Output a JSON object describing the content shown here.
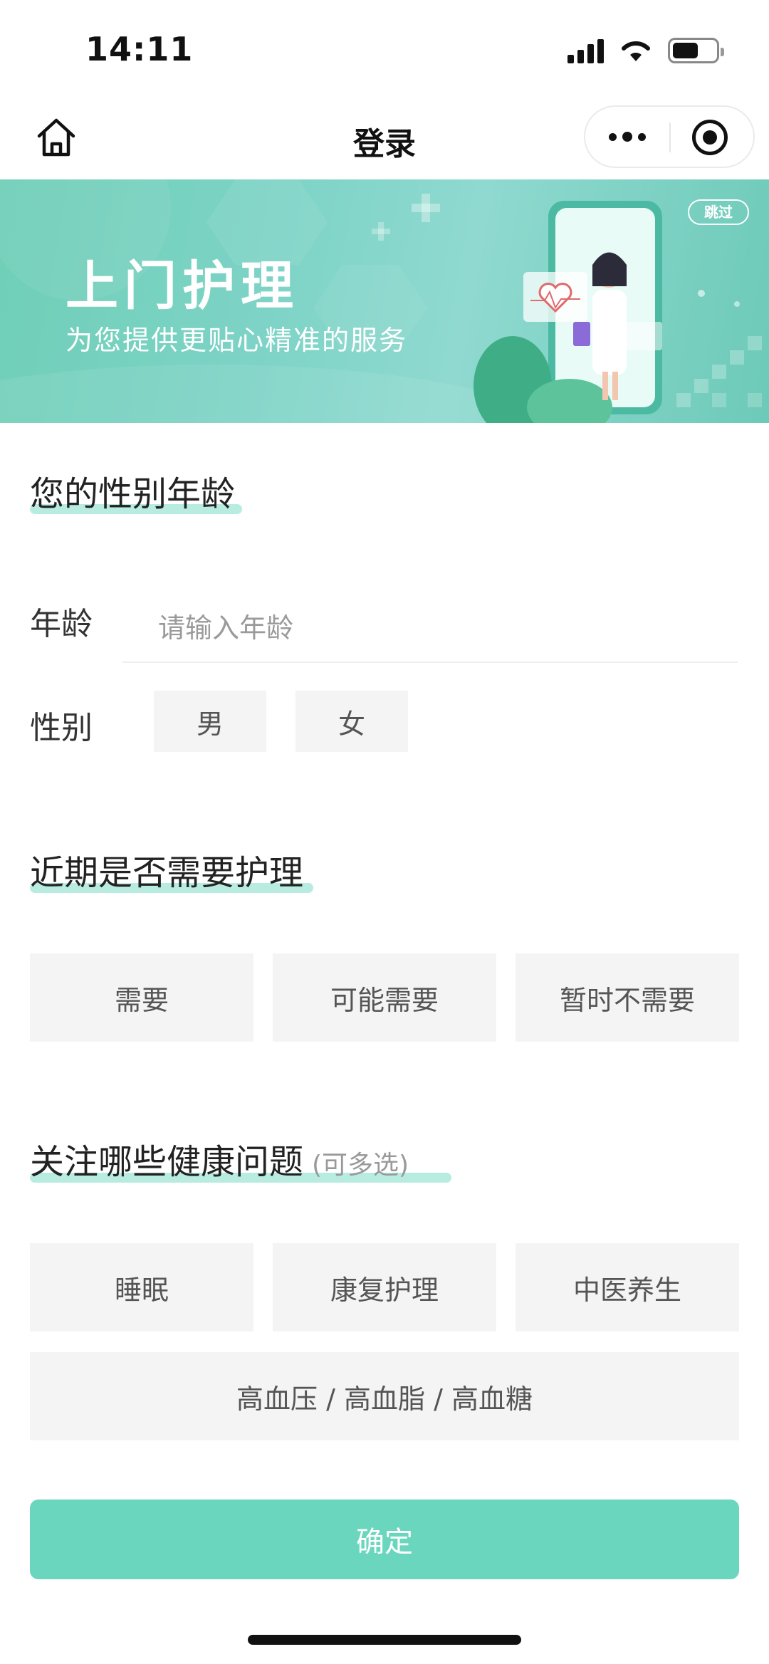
{
  "status_bar": {
    "time": "14:11",
    "icons": [
      "cellular-signal-icon",
      "wifi-icon",
      "battery-icon"
    ],
    "battery_level": 0.6
  },
  "nav": {
    "title": "登录",
    "home_icon": "home-icon",
    "more_icon": "more-dots-icon",
    "close_icon": "miniprogram-close-icon"
  },
  "banner": {
    "title": "上门护理",
    "subtitle": "为您提供更贴心精准的服务",
    "skip_label": "跳过"
  },
  "section_gender_age": {
    "title": "您的性别年龄",
    "age_label": "年龄",
    "age_placeholder": "请输入年龄",
    "age_value": "",
    "gender_label": "性别",
    "gender_options": [
      "男",
      "女"
    ]
  },
  "section_care_need": {
    "title": "近期是否需要护理",
    "options": [
      "需要",
      "可能需要",
      "暂时不需要"
    ]
  },
  "section_health": {
    "title": "关注哪些健康问题",
    "hint": "(可多选)",
    "options": [
      "睡眠",
      "康复护理",
      "中医养生",
      "高血压 / 高血脂 / 高血糖"
    ]
  },
  "confirm_label": "确定",
  "colors": {
    "accent": "#6ad6bd",
    "underline": "#b9ece0",
    "chip_bg": "#f4f4f4",
    "banner_start": "#6fcfb7",
    "banner_end": "#8fd9d0"
  }
}
